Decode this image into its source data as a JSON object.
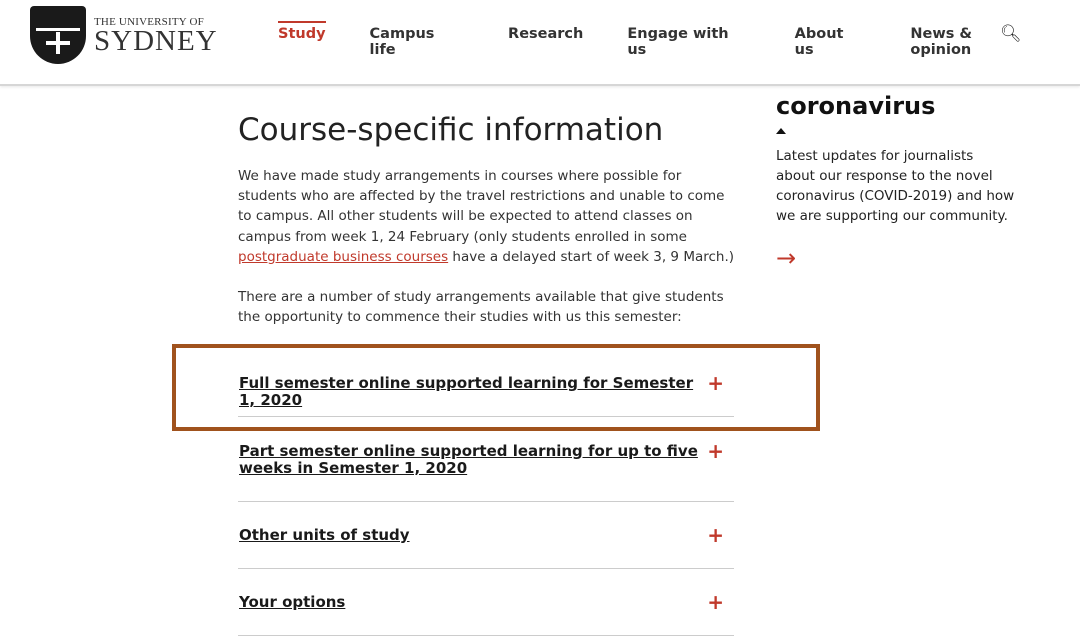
{
  "header": {
    "logo_small": "THE UNIVERSITY OF",
    "logo_big": "SYDNEY",
    "nav": [
      "Study",
      "Campus life",
      "Research",
      "Engage with us",
      "About us",
      "News & opinion"
    ],
    "active_nav": "Study",
    "accent": "#c0392b"
  },
  "main": {
    "title": "Course-specific information",
    "para1_a": "We have made study arrangements in courses where possible for students who are affected by the travel restrictions and unable to come to campus. All other students will be expected to attend classes on campus from week 1, 24 February (only students enrolled in some ",
    "para1_link": "postgraduate business courses",
    "para1_b": " have a delayed start of week 3, 9 March.)",
    "para2": "There are a number of study arrangements available that give students the opportunity to commence their studies with us this semester:",
    "accordions": [
      {
        "label": "Full semester online supported learning for Semester 1, 2020"
      },
      {
        "label": "Part semester online supported learning for up to five weeks in Semester 1, 2020"
      },
      {
        "label": "Other units of study"
      },
      {
        "label": "Your options"
      }
    ]
  },
  "sidebar": {
    "heading": "coronavirus",
    "text": "Latest updates for journalists about our response to the novel coronavirus (COVID-2019) and how we are supporting our community."
  }
}
